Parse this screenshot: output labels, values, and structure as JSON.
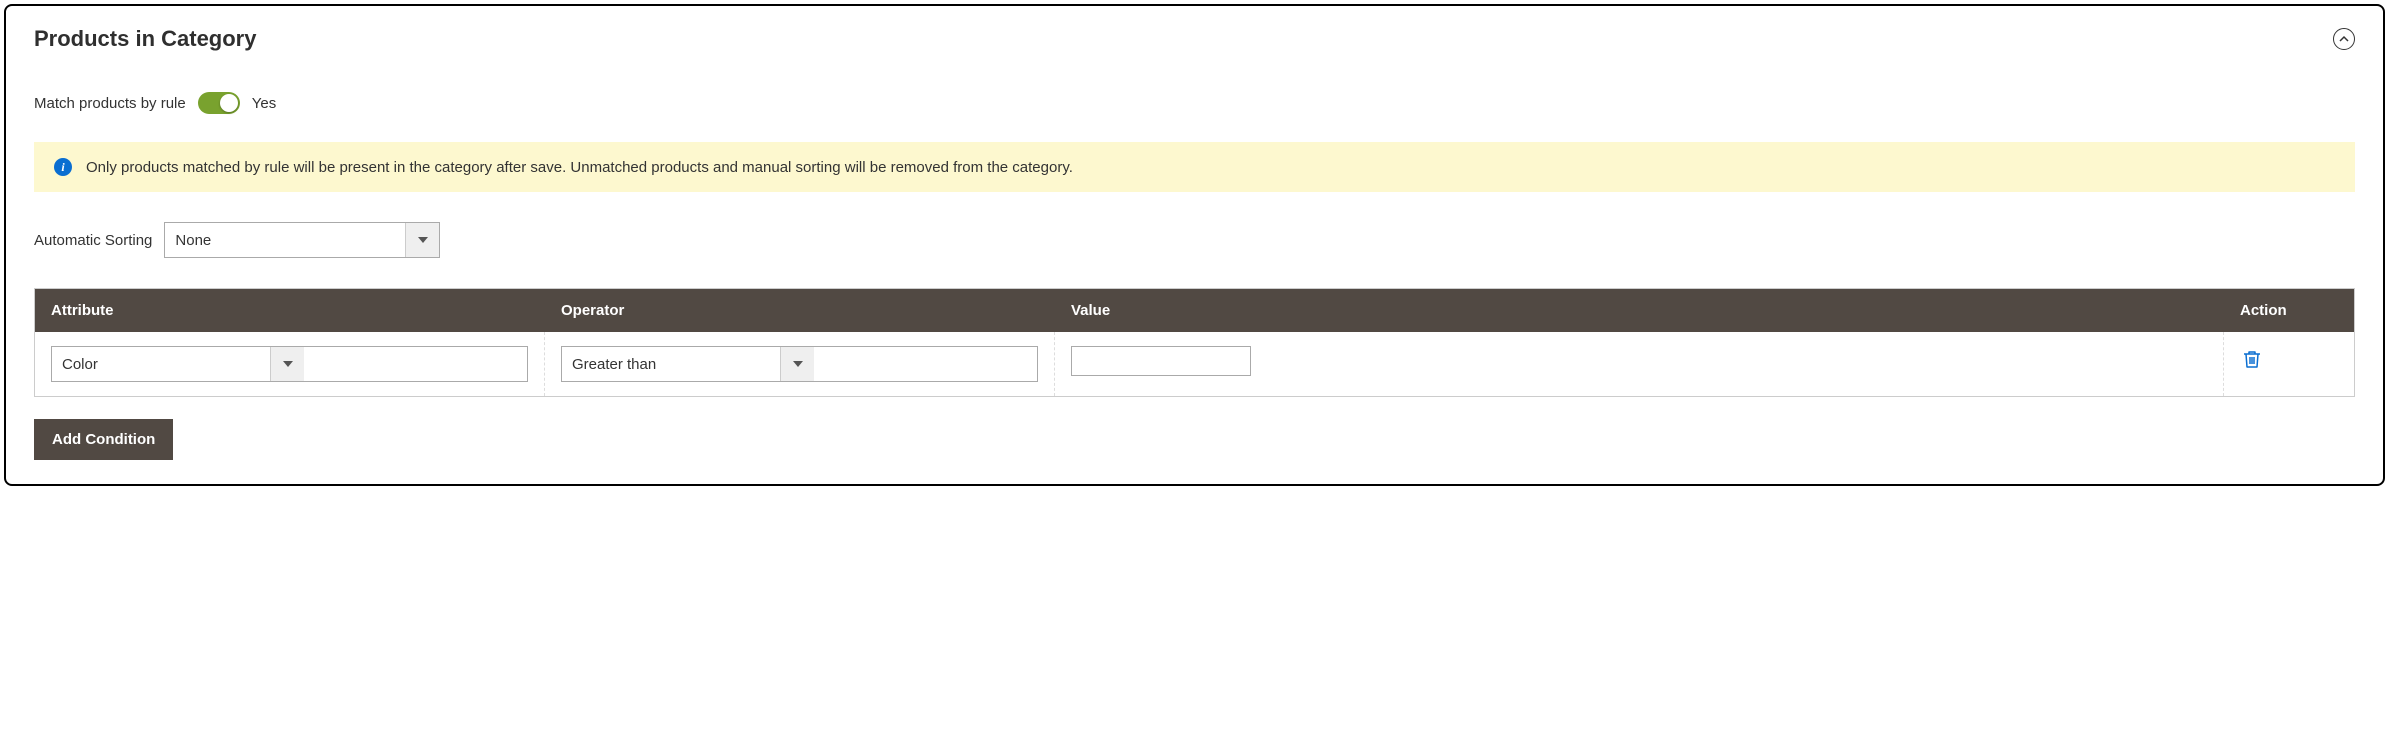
{
  "panel": {
    "title": "Products in Category"
  },
  "toggle": {
    "label": "Match products by rule",
    "value": "Yes"
  },
  "info": {
    "text": "Only products matched by rule will be present in the category after save. Unmatched products and manual sorting will be removed from the category."
  },
  "sorting": {
    "label": "Automatic Sorting",
    "value": "None"
  },
  "table": {
    "headers": {
      "attribute": "Attribute",
      "operator": "Operator",
      "value": "Value",
      "action": "Action"
    },
    "row": {
      "attribute": "Color",
      "operator": "Greater than",
      "value": ""
    }
  },
  "add_button": "Add Condition"
}
